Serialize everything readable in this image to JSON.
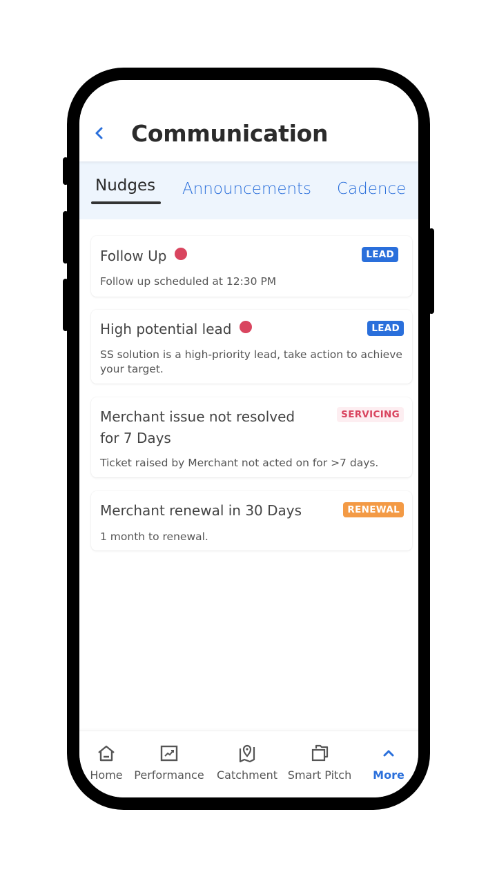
{
  "header": {
    "back_icon": "chevron-left-icon",
    "title": "Communication"
  },
  "tabs": [
    {
      "label": "Nudges",
      "active": true
    },
    {
      "label": "Announcements",
      "active": false
    },
    {
      "label": "Cadence",
      "active": false
    }
  ],
  "nudges": [
    {
      "title": "Follow Up",
      "unread": true,
      "description": "Follow up scheduled at 12:30 PM",
      "badge": "LEAD",
      "badge_type": "lead"
    },
    {
      "title": "High potential lead",
      "unread": true,
      "description": "SS solution is a high-priority lead, take action to achieve your target.",
      "badge": "LEAD",
      "badge_type": "lead"
    },
    {
      "title": "Merchant issue not resolved for 7 Days",
      "unread": false,
      "description": "Ticket raised by Merchant not acted on for >7 days.",
      "badge": "SERVICING",
      "badge_type": "servicing"
    },
    {
      "title": "Merchant renewal in 30 Days",
      "unread": false,
      "description": "1 month to renewal.",
      "badge": "RENEWAL",
      "badge_type": "renewal"
    }
  ],
  "colors": {
    "accent": "#2a6fdb",
    "unread_dot": "#d9455f",
    "lead_badge": "#2a6fdb",
    "servicing_badge_text": "#d9455f",
    "servicing_badge_bg": "#fdeef1",
    "renewal_badge": "#f39a45",
    "tab_bar_bg": "#eef5fd"
  },
  "bottom_nav": [
    {
      "label": "Home",
      "icon": "home-icon",
      "active": false
    },
    {
      "label": "Performance",
      "icon": "chart-trend-icon",
      "active": false
    },
    {
      "label": "Catchment",
      "icon": "map-pin-icon",
      "active": false
    },
    {
      "label": "Smart Pitch",
      "icon": "stacked-pages-icon",
      "active": false
    },
    {
      "label": "More",
      "icon": "chevron-up-icon",
      "active": true
    }
  ]
}
